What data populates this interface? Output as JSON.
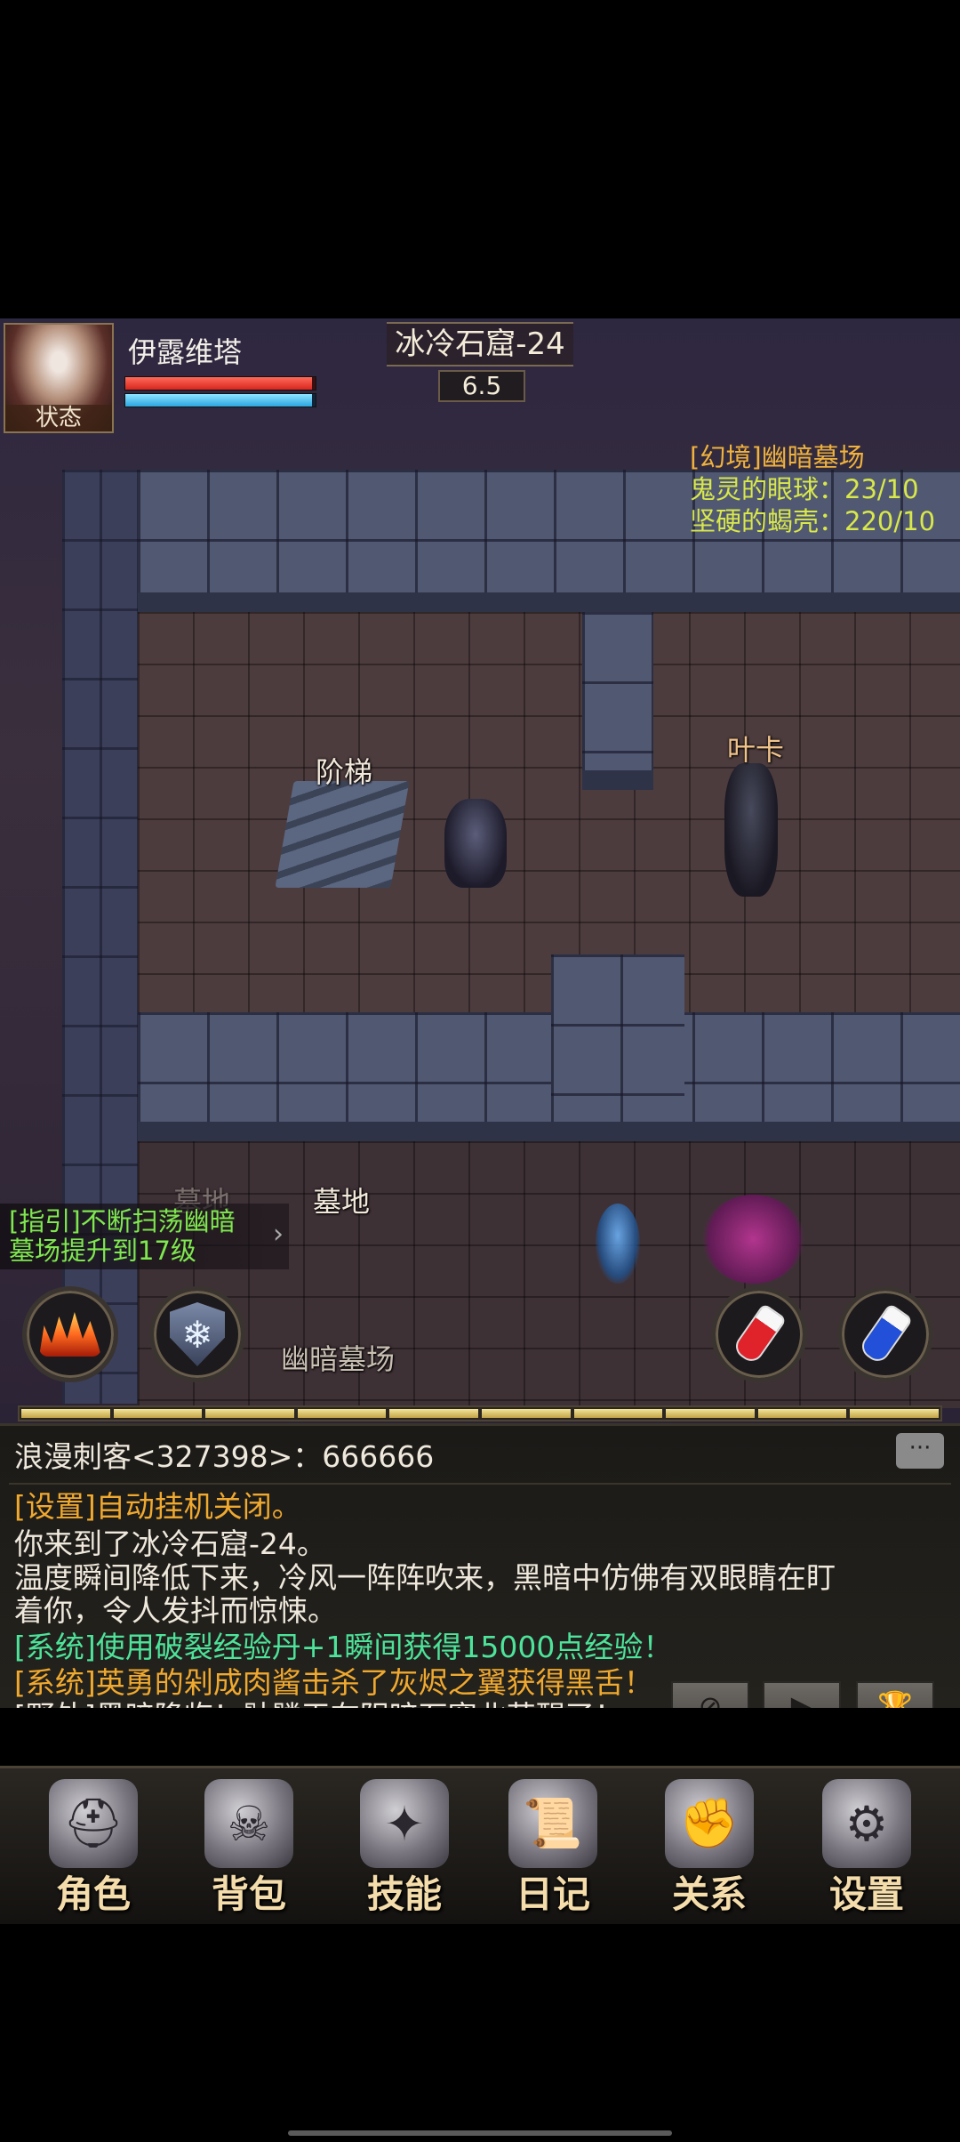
{
  "player": {
    "name": "伊露维塔",
    "avatar_label": "状态",
    "hp_fraction": 0.98,
    "mp_fraction": 0.98
  },
  "location": {
    "map_name": "冰冷石窟-24",
    "map_level": "6.5"
  },
  "quest": {
    "title": "[幻境]幽暗墓场",
    "items": [
      "鬼灵的眼球：23/10",
      "坚硬的蝎壳：220/10"
    ]
  },
  "map_labels": {
    "stairs": "阶梯",
    "npc": "叶卡",
    "graveyard_faded": "墓地",
    "graveyard": "墓地",
    "dark_graveyard": "幽暗墓场"
  },
  "guide": {
    "text_line1": "[指引]不断扫荡幽暗",
    "text_line2": "墓场提升到17级",
    "arrow": "›"
  },
  "skills": {
    "left": [
      "fire-skill-icon",
      "frost-shield-icon"
    ],
    "right": [
      "red-potion-icon",
      "blue-potion-icon"
    ],
    "frost_glyph": "❄"
  },
  "exp": {
    "segments": 10
  },
  "chat": {
    "world_message": "浪漫刺客<327398>：666666",
    "chat_icon": "···",
    "messages": [
      {
        "text": "[设置]自动挂机关闭。",
        "color": "orange"
      },
      {
        "text": "你来到了冰冷石窟-24。",
        "color": "white"
      },
      {
        "text": "温度瞬间降低下来，冷风一阵阵吹来，黑暗中仿佛有双眼睛在盯",
        "color": "white"
      },
      {
        "text": "着你，令人发抖而惊悚。",
        "color": "white"
      },
      {
        "text": "[系统]使用破裂经验丹+1瞬间获得15000点经验！",
        "color": "green"
      },
      {
        "text": "[系统]英勇的剁成肉酱击杀了灰烬之翼获得黑舌！",
        "color": "orange"
      },
      {
        "text": "[野外]黑暗降临！骷髅王在阴暗石窟北苏醒了！",
        "color": "white"
      }
    ],
    "controls": {
      "compass": "⊘",
      "play": "▶",
      "trophy": "🏆"
    }
  },
  "nav": [
    {
      "label": "角色",
      "icon": "helmet-icon",
      "glyph": "⛑"
    },
    {
      "label": "背包",
      "icon": "backpack-icon",
      "glyph": "☠"
    },
    {
      "label": "技能",
      "icon": "skill-book-icon",
      "glyph": "✦"
    },
    {
      "label": "日记",
      "icon": "scroll-icon",
      "glyph": "📜"
    },
    {
      "label": "关系",
      "icon": "handshake-icon",
      "glyph": "✊"
    },
    {
      "label": "设置",
      "icon": "gear-icon",
      "glyph": "⚙"
    }
  ]
}
